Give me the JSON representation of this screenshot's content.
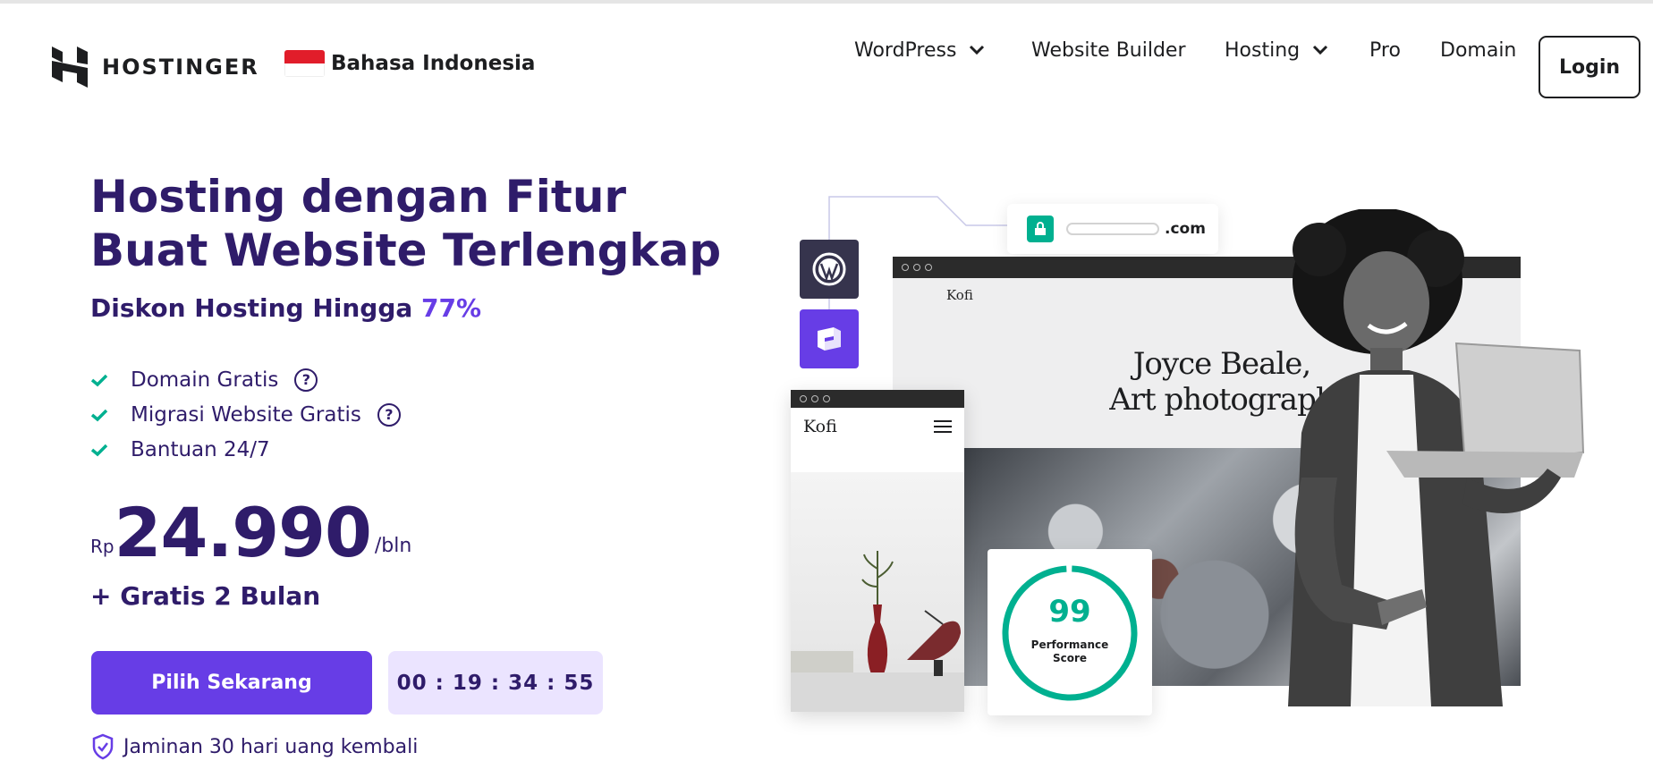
{
  "brand": {
    "name": "HOSTINGER"
  },
  "language": {
    "label": "Bahasa Indonesia",
    "flag_colors": [
      "#e11d2a",
      "#ffffff"
    ]
  },
  "nav": {
    "items": [
      {
        "label": "WordPress",
        "has_dropdown": true
      },
      {
        "label": "Website Builder",
        "has_dropdown": false
      },
      {
        "label": "Hosting",
        "has_dropdown": true
      },
      {
        "label": "Pro",
        "has_dropdown": false
      },
      {
        "label": "Domain",
        "has_dropdown": false
      }
    ],
    "login_label": "Login"
  },
  "hero": {
    "headline_line1": "Hosting dengan Fitur",
    "headline_line2": "Buat Website Terlengkap",
    "subline": "Diskon Hosting Hingga",
    "discount": "77%",
    "features": [
      {
        "label": "Domain Gratis",
        "help": "?"
      },
      {
        "label": "Migrasi Website Gratis",
        "help": "?"
      },
      {
        "label": "Bantuan 24/7"
      }
    ],
    "price": {
      "currency": "Rp",
      "amount": "24.990",
      "period": "/bln"
    },
    "bonus": "+ Gratis 2 Bulan",
    "cta_label": "Pilih Sekarang",
    "countdown": "00 : 19 : 34 : 55",
    "guarantee": "Jaminan 30 hari uang kembali"
  },
  "illustration": {
    "url_tld": ".com",
    "desktop_brand": "Kofi",
    "desktop_title_line1": "Joyce Beale,",
    "desktop_title_line2": "Art photograph",
    "phone_brand": "Kofi",
    "performance_score": "99",
    "performance_label_line1": "Performance",
    "performance_label_line2": "Score"
  },
  "colors": {
    "primary": "#673de6",
    "text_dark": "#2f1c6a",
    "accent_green": "#00b090",
    "timer_bg": "#ebe4ff"
  }
}
